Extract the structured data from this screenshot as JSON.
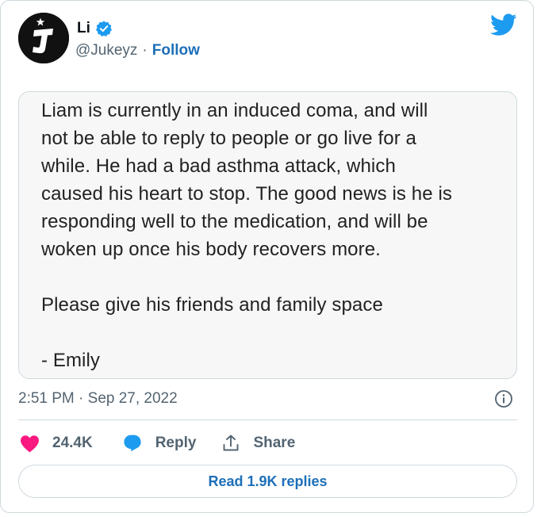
{
  "author": {
    "display_name": "Li",
    "handle": "@Jukeyz",
    "follow_label": "Follow",
    "separator": "·",
    "avatar_icon": "jukeyz-logo-avatar",
    "verified_icon": "verified-badge-icon",
    "verified_color": "#1d9bf0"
  },
  "platform_icon": "twitter-bird-icon",
  "platform_color": "#1d9bf0",
  "quote": {
    "paragraphs": [
      [
        "Liam is currently in an induced coma, and will",
        "not be able to reply to people or go live for a",
        "while. He had a bad asthma attack, which",
        "caused his heart to stop. The good news is he is",
        "responding well to the medication, and will be",
        "woken up once his body recovers more."
      ],
      [
        "Please give his friends and family space"
      ],
      [
        "- Emily"
      ]
    ]
  },
  "timestamp": "2:51 PM · Sep 27, 2022",
  "actions": {
    "like_count": "24.4K",
    "like_color": "#f91880",
    "reply_label": "Reply",
    "reply_color": "#1d9bf0",
    "share_label": "Share"
  },
  "read_replies_label": "Read 1.9K replies",
  "link_color": "#1d6fb8"
}
